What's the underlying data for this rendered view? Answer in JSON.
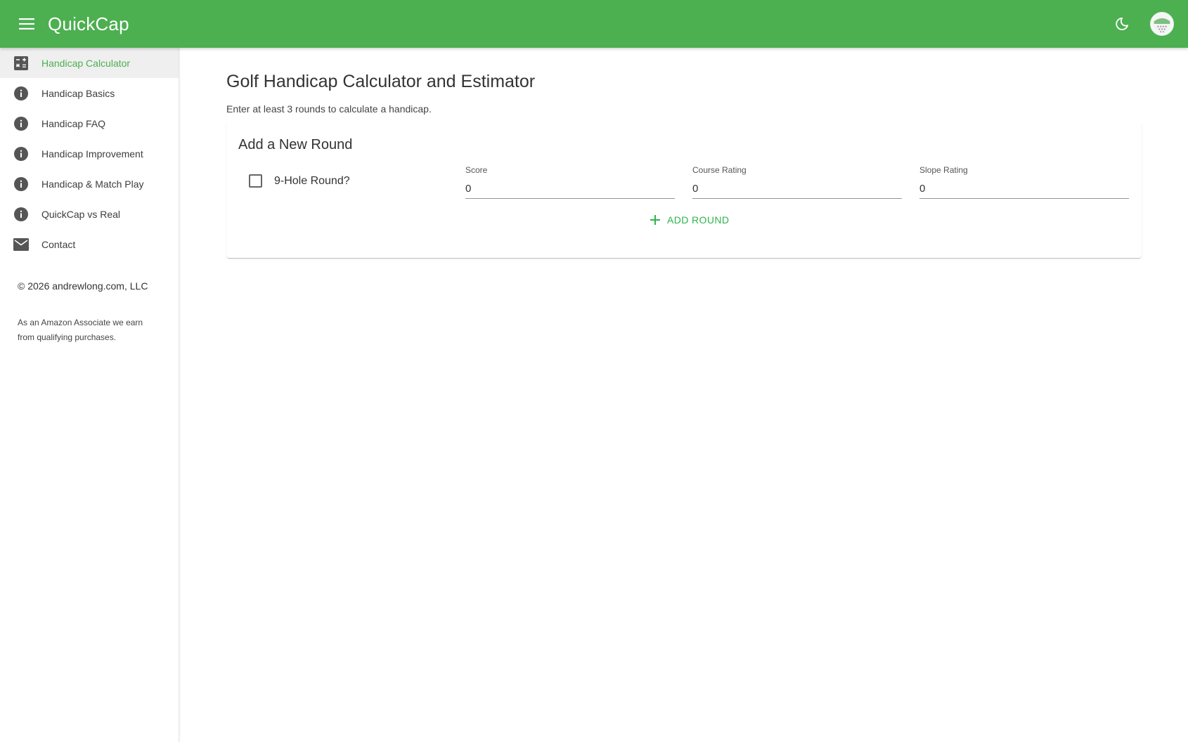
{
  "app": {
    "title": "QuickCap"
  },
  "header": {
    "menu_icon": "hamburger-menu-icon",
    "theme_icon": "moon-icon",
    "avatar_icon": "golf-ball-avatar"
  },
  "colors": {
    "brand": "#4caf50",
    "accent": "#2db44d"
  },
  "sidebar": {
    "items": [
      {
        "label": "Handicap Calculator",
        "icon": "calculator-icon",
        "active": true
      },
      {
        "label": "Handicap Basics",
        "icon": "info-icon"
      },
      {
        "label": "Handicap FAQ",
        "icon": "info-icon"
      },
      {
        "label": "Handicap Improvement",
        "icon": "info-icon"
      },
      {
        "label": "Handicap & Match Play",
        "icon": "info-icon"
      },
      {
        "label": "QuickCap vs Real",
        "icon": "info-icon"
      },
      {
        "label": "Contact",
        "icon": "mail-icon"
      }
    ],
    "copyright": "© 2026 andrewlong.com, LLC",
    "affiliate": "As an Amazon Associate we earn from qualifying purchases."
  },
  "main": {
    "title": "Golf Handicap Calculator and Estimator",
    "subtitle": "Enter at least 3 rounds to calculate a handicap.",
    "card": {
      "title": "Add a New Round",
      "nine_hole_label": "9-Hole Round?",
      "fields": [
        {
          "label": "Score",
          "value": "0"
        },
        {
          "label": "Course Rating",
          "value": "0"
        },
        {
          "label": "Slope Rating",
          "value": "0"
        }
      ],
      "add_button": "ADD ROUND"
    }
  }
}
